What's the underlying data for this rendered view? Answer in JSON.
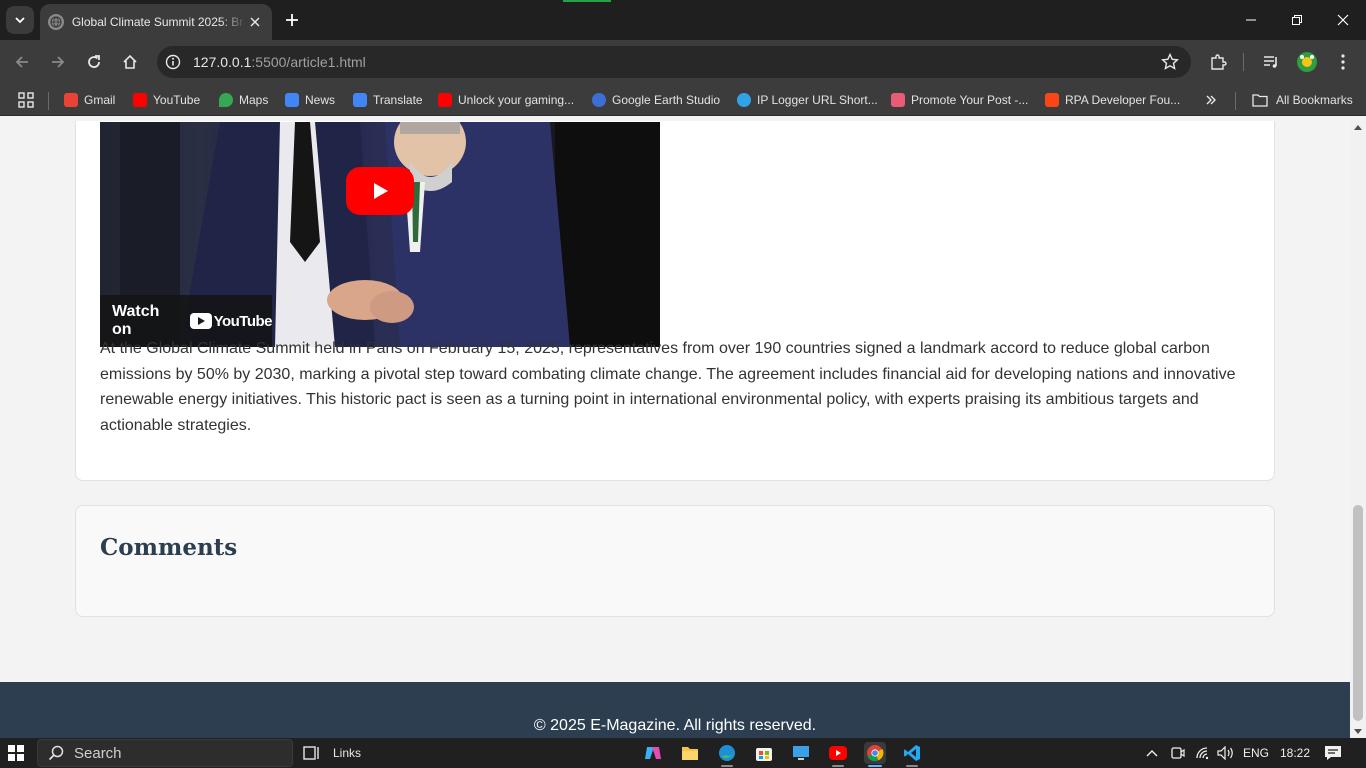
{
  "browser": {
    "tab_title": "Global Climate Summit 2025: Br",
    "url_host": "127.0.0.1",
    "url_path": ":5500/article1.html",
    "bookmarks": [
      {
        "label": "Gmail",
        "icon": "gmail-icon",
        "color": "#ea4335"
      },
      {
        "label": "YouTube",
        "icon": "youtube-icon",
        "color": "#ff0000"
      },
      {
        "label": "Maps",
        "icon": "maps-icon",
        "color": "#34a853"
      },
      {
        "label": "News",
        "icon": "news-icon",
        "color": "#4285f4"
      },
      {
        "label": "Translate",
        "icon": "translate-icon",
        "color": "#4285f4"
      },
      {
        "label": "Unlock your gaming...",
        "icon": "youtube-icon",
        "color": "#ff0000"
      },
      {
        "label": "Google Earth Studio",
        "icon": "earth-icon",
        "color": "#3b6fd6"
      },
      {
        "label": "IP Logger URL Short...",
        "icon": "iplogger-icon",
        "color": "#2fa3e6"
      },
      {
        "label": "Promote Your Post -...",
        "icon": "rocket-icon",
        "color": "#e85d75"
      },
      {
        "label": "RPA Developer Fou...",
        "icon": "uipath-icon",
        "color": "#fa4616"
      }
    ],
    "all_bookmarks": "All Bookmarks"
  },
  "article": {
    "watch_on": "Watch on",
    "youtube_wordmark": "YouTube",
    "body": "At the Global Climate Summit held in Paris on February 15, 2025, representatives from over 190 countries signed a landmark accord to reduce global carbon emissions by 50% by 2030, marking a pivotal step toward combating climate change. The agreement includes financial aid for developing nations and innovative renewable energy initiatives. This historic pact is seen as a turning point in international environmental policy, with experts praising its ambitious targets and actionable strategies."
  },
  "comments": {
    "title": "Comments"
  },
  "footer": {
    "text": "© 2025 E-Magazine. All rights reserved."
  },
  "taskbar": {
    "search_placeholder": "Search",
    "links_label": "Links",
    "language": "ENG",
    "time": "18:22"
  }
}
